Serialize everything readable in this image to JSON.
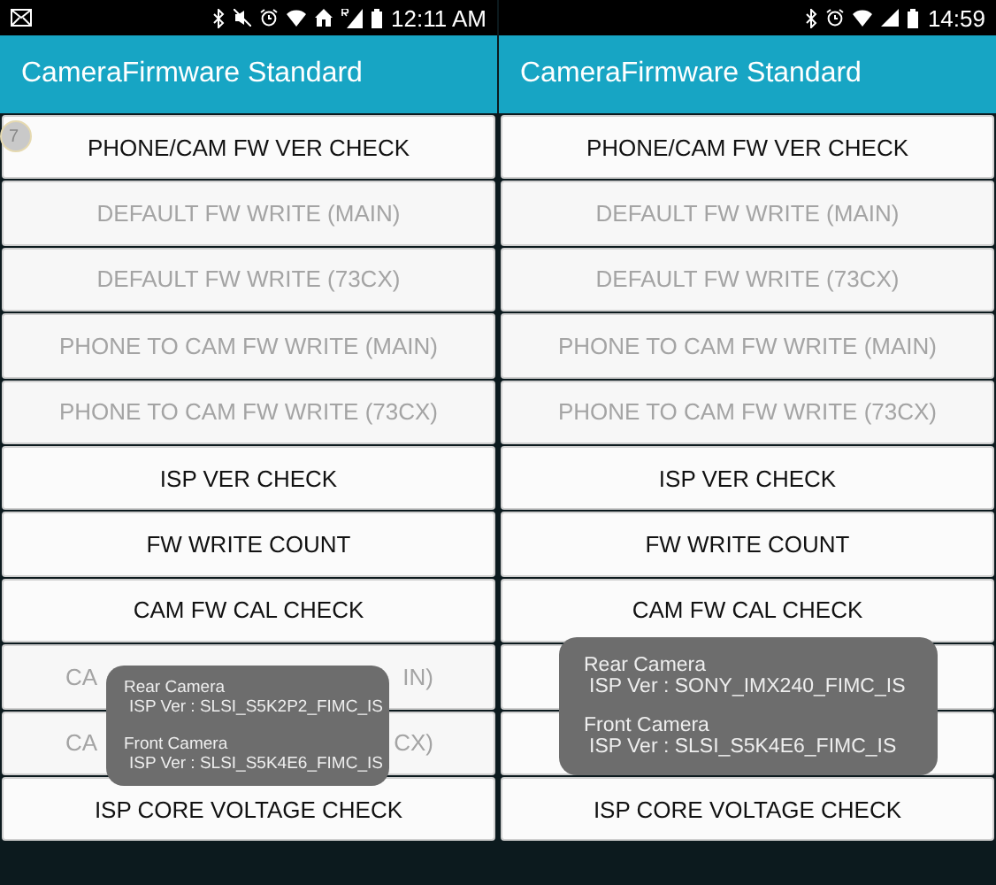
{
  "phones": [
    {
      "status_bar": {
        "left_icons": [
          {
            "kind": "mail"
          }
        ],
        "icons": [
          {
            "kind": "bluetooth"
          },
          {
            "kind": "mute"
          },
          {
            "kind": "alarm"
          },
          {
            "kind": "wifi"
          },
          {
            "kind": "home"
          },
          {
            "kind": "signal-r"
          },
          {
            "kind": "battery"
          }
        ],
        "time": "12:11 AM"
      },
      "title": "CameraFirmware Standard",
      "touch_marker": "7",
      "buttons": [
        {
          "kind": "text",
          "label": "PHONE/CAM FW VER CHECK",
          "disabled": false
        },
        {
          "kind": "text",
          "label": "DEFAULT FW WRITE (MAIN)",
          "disabled": true
        },
        {
          "kind": "text",
          "label": "DEFAULT FW WRITE (73CX)",
          "disabled": true
        },
        {
          "kind": "text",
          "label": "PHONE TO CAM FW WRITE (MAIN)",
          "disabled": true
        },
        {
          "kind": "text",
          "label": "PHONE TO CAM FW WRITE (73CX)",
          "disabled": true
        },
        {
          "kind": "text",
          "label": "ISP VER CHECK",
          "disabled": false
        },
        {
          "kind": "text",
          "label": "FW WRITE COUNT",
          "disabled": false
        },
        {
          "kind": "text",
          "label": "CAM FW CAL CHECK",
          "disabled": false
        },
        {
          "kind": "split",
          "label_parts": [
            "CA",
            "IN)"
          ],
          "disabled": true
        },
        {
          "kind": "split",
          "label_parts": [
            "CA",
            "CX)"
          ],
          "disabled": true
        },
        {
          "kind": "text",
          "label": "ISP CORE VOLTAGE CHECK",
          "disabled": false
        }
      ],
      "toast": [
        {
          "camera": "Rear Camera",
          "version": "ISP Ver : SLSI_S5K2P2_FIMC_IS"
        },
        {
          "camera": "Front Camera",
          "version": "ISP Ver : SLSI_S5K4E6_FIMC_IS"
        }
      ]
    },
    {
      "status_bar": {
        "icons": [
          {
            "kind": "bluetooth"
          },
          {
            "kind": "alarm"
          },
          {
            "kind": "wifi"
          },
          {
            "kind": "signal"
          },
          {
            "kind": "battery"
          }
        ],
        "time": "14:59"
      },
      "title": "CameraFirmware Standard",
      "buttons": [
        {
          "kind": "text",
          "label": "PHONE/CAM FW VER CHECK",
          "disabled": false
        },
        {
          "kind": "text",
          "label": "DEFAULT FW WRITE (MAIN)",
          "disabled": true
        },
        {
          "kind": "text",
          "label": "DEFAULT FW WRITE (73CX)",
          "disabled": true
        },
        {
          "kind": "text",
          "label": "PHONE TO CAM FW WRITE (MAIN)",
          "disabled": true
        },
        {
          "kind": "text",
          "label": "PHONE TO CAM FW WRITE (73CX)",
          "disabled": true
        },
        {
          "kind": "text",
          "label": "ISP VER CHECK",
          "disabled": false
        },
        {
          "kind": "text",
          "label": "FW WRITE COUNT",
          "disabled": false
        },
        {
          "kind": "text",
          "label": "CAM FW CAL CHECK",
          "disabled": false
        },
        {
          "kind": "blank"
        },
        {
          "kind": "blank"
        },
        {
          "kind": "text",
          "label": "ISP CORE VOLTAGE CHECK",
          "disabled": false
        }
      ],
      "toast": [
        {
          "camera": "Rear Camera",
          "version": "ISP Ver : SONY_IMX240_FIMC_IS"
        },
        {
          "camera": "Front Camera",
          "version": "ISP Ver : SLSI_S5K4E6_FIMC_IS"
        }
      ]
    }
  ]
}
